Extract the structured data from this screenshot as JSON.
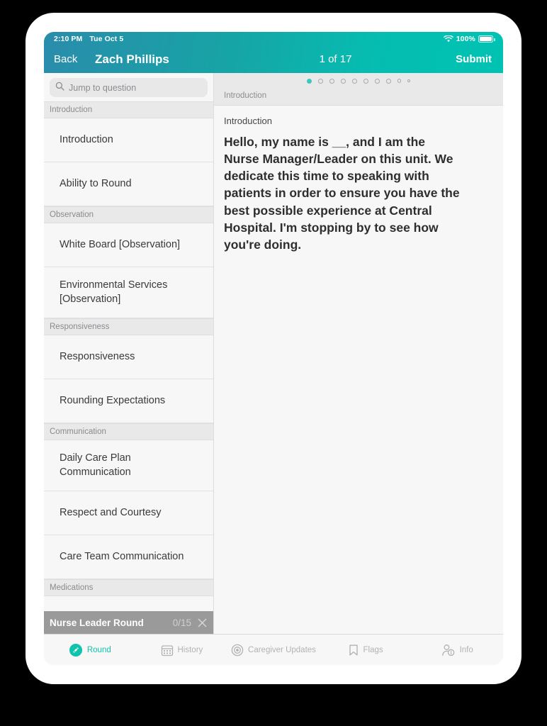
{
  "statusbar": {
    "time": "2:10 PM",
    "date": "Tue Oct 5",
    "battery_percent": "100%",
    "wifi_icon": "wifi-icon",
    "battery_icon": "battery-icon"
  },
  "navbar": {
    "back_label": "Back",
    "patient_name": "Zach Phillips",
    "progress": "1 of 17",
    "submit_label": "Submit"
  },
  "sidebar": {
    "search_placeholder": "Jump to question",
    "search_value": "",
    "search_icon": "search-icon",
    "sections": [
      {
        "title": "Introduction",
        "items": [
          "Introduction",
          "Ability to Round"
        ]
      },
      {
        "title": "Observation",
        "items": [
          "White Board [Observation]",
          "Environmental Services [Observation]"
        ]
      },
      {
        "title": "Responsiveness",
        "items": [
          "Responsiveness",
          "Rounding Expectations"
        ]
      },
      {
        "title": "Communication",
        "items": [
          "Daily Care Plan Communication",
          "Respect and Courtesy",
          "Care Team Communication"
        ]
      },
      {
        "title": "Medications",
        "items": []
      }
    ],
    "round_bar": {
      "title": "Nurse Leader Round",
      "count": "0/15",
      "close_icon": "close-icon"
    }
  },
  "content": {
    "pager": {
      "total_dots": 10,
      "active_index": 0
    },
    "breadcrumb": "Introduction",
    "question_label": "Introduction",
    "question_text": "Hello, my name is __, and I am the Nurse Manager/Leader on this unit. We dedicate this time to speaking with patients in order to ensure you have the best possible experience at Central Hospital. I'm stopping by to see how you're doing."
  },
  "tabbar": {
    "tabs": [
      {
        "label": "Round",
        "icon": "round-icon",
        "active": true
      },
      {
        "label": "History",
        "icon": "calendar-icon",
        "active": false
      },
      {
        "label": "Caregiver Updates",
        "icon": "target-icon",
        "active": false
      },
      {
        "label": "Flags",
        "icon": "bookmark-icon",
        "active": false
      },
      {
        "label": "Info",
        "icon": "person-info-icon",
        "active": false
      }
    ]
  },
  "colors": {
    "accent_teal": "#0fc3ad",
    "header_gradient_start": "#2a8cab",
    "header_gradient_end": "#00c2b2",
    "round_bar_gray": "#9a9a9a"
  }
}
